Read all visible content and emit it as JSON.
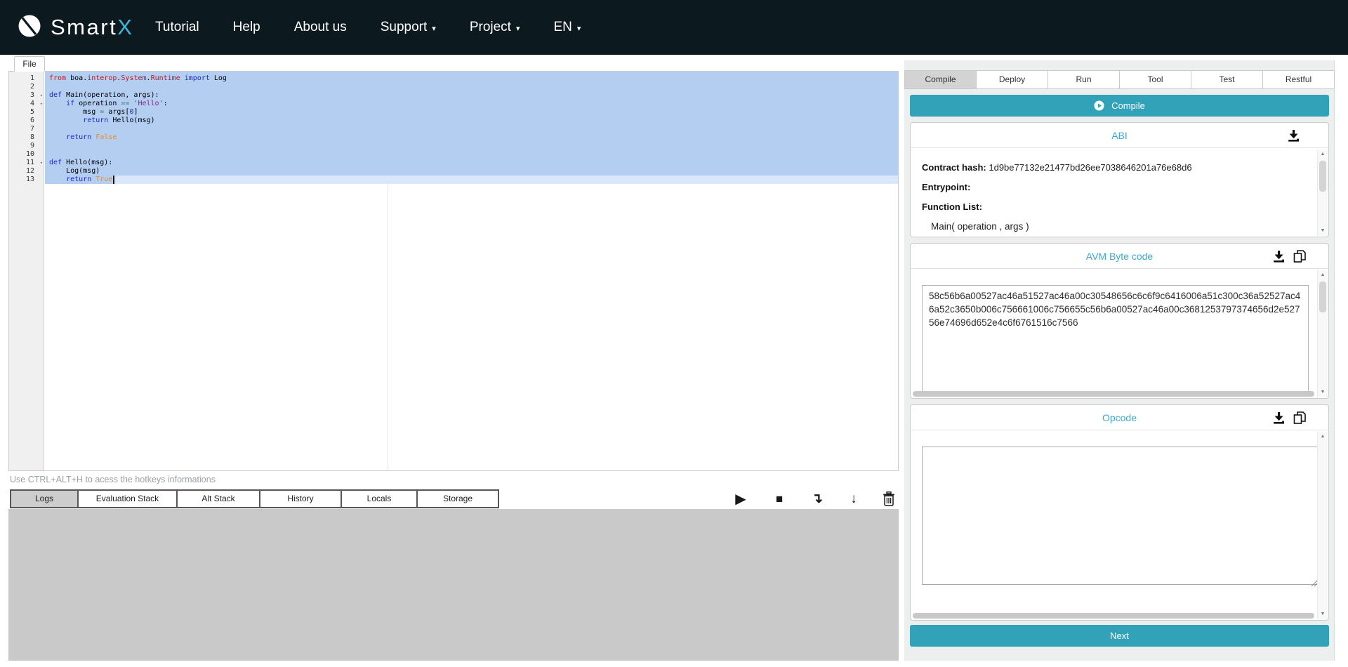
{
  "navbar": {
    "brand": {
      "prefix": "Smart",
      "suffix": "X"
    },
    "items": [
      {
        "label": "Tutorial",
        "caret": false
      },
      {
        "label": "Help",
        "caret": false
      },
      {
        "label": "About us",
        "caret": false
      },
      {
        "label": "Support",
        "caret": true
      },
      {
        "label": "Project",
        "caret": true
      },
      {
        "label": "EN",
        "caret": true
      }
    ]
  },
  "file_tab_label": "File",
  "editor": {
    "hint": "Use CTRL+ALT+H to acess the hotkeys informations",
    "lines": [
      {
        "n": 1,
        "fold": false,
        "tokens": [
          [
            "from",
            "red"
          ],
          [
            " ",
            "p"
          ],
          [
            "boa",
            ""
          ],
          [
            ".",
            "p"
          ],
          [
            "interop",
            "red"
          ],
          [
            ".",
            "p"
          ],
          [
            "System",
            "red"
          ],
          [
            ".",
            "p"
          ],
          [
            "Runtime",
            "red"
          ],
          [
            " ",
            "p"
          ],
          [
            "import",
            "kw"
          ],
          [
            " Log",
            "p"
          ]
        ]
      },
      {
        "n": 2,
        "tokens": []
      },
      {
        "n": 3,
        "fold": true,
        "tokens": [
          [
            "def",
            "kw"
          ],
          [
            " Main(operation, args):",
            "p"
          ]
        ]
      },
      {
        "n": 4,
        "fold": true,
        "tokens": [
          [
            "    ",
            "p"
          ],
          [
            "if",
            "kw"
          ],
          [
            " operation ",
            "p"
          ],
          [
            "==",
            "op"
          ],
          [
            " ",
            "p"
          ],
          [
            "'Hello'",
            "str"
          ],
          [
            ":",
            "p"
          ]
        ]
      },
      {
        "n": 5,
        "tokens": [
          [
            "        msg ",
            "p"
          ],
          [
            "=",
            "op"
          ],
          [
            " args[",
            "p"
          ],
          [
            "0",
            "num"
          ],
          [
            "]",
            "p"
          ]
        ]
      },
      {
        "n": 6,
        "tokens": [
          [
            "        ",
            "p"
          ],
          [
            "return",
            "kw"
          ],
          [
            " Hello(msg)",
            "p"
          ]
        ]
      },
      {
        "n": 7,
        "tokens": []
      },
      {
        "n": 8,
        "tokens": [
          [
            "    ",
            "p"
          ],
          [
            "return",
            "kw"
          ],
          [
            " ",
            "p"
          ],
          [
            "False",
            "const"
          ]
        ]
      },
      {
        "n": 9,
        "tokens": []
      },
      {
        "n": 10,
        "tokens": []
      },
      {
        "n": 11,
        "fold": true,
        "tokens": [
          [
            "def",
            "kw"
          ],
          [
            " Hello(msg):",
            "p"
          ]
        ]
      },
      {
        "n": 12,
        "tokens": [
          [
            "    Log(msg)",
            "p"
          ]
        ]
      },
      {
        "n": 13,
        "active": true,
        "tokens": [
          [
            "    ",
            "p"
          ],
          [
            "return",
            "kw"
          ],
          [
            " ",
            "p"
          ],
          [
            "True",
            "const"
          ]
        ]
      }
    ]
  },
  "debug_toolbar": {
    "tabs": [
      {
        "label": "Logs",
        "active": true
      },
      {
        "label": "Evaluation Stack",
        "active": false
      },
      {
        "label": "Alt Stack",
        "active": false
      },
      {
        "label": "History",
        "active": false
      },
      {
        "label": "Locals",
        "active": false
      },
      {
        "label": "Storage",
        "active": false
      }
    ],
    "icons": [
      {
        "name": "run-icon",
        "glyph": "▶",
        "cls": "gl-play"
      },
      {
        "name": "stop-icon",
        "glyph": "■",
        "cls": "gl-stop"
      },
      {
        "name": "step-over-icon",
        "glyph": "↴",
        "cls": "gl-arr"
      },
      {
        "name": "step-into-icon",
        "glyph": "↓",
        "cls": "gl-arr"
      },
      {
        "name": "clear-logs-icon",
        "glyph": "trash",
        "cls": ""
      }
    ]
  },
  "panel": {
    "tabs": [
      {
        "label": "Compile",
        "active": true
      },
      {
        "label": "Deploy",
        "active": false
      },
      {
        "label": "Run",
        "active": false
      },
      {
        "label": "Tool",
        "active": false
      },
      {
        "label": "Test",
        "active": false
      },
      {
        "label": "Restful",
        "active": false
      }
    ],
    "compile_button_label": "Compile",
    "abi": {
      "title": "ABI",
      "contract_hash_label": "Contract hash:",
      "contract_hash": "1d9be77132e21477bd26ee7038646201a76e68d6",
      "entrypoint_label": "Entrypoint:",
      "function_list_label": "Function List:",
      "function_signature": "Main( operation , args )"
    },
    "avm": {
      "title": "AVM Byte code",
      "bytecode": "58c56b6a00527ac46a51527ac46a00c30548656c6c6f9c6416006a51c300c36a52527ac46a52c3650b006c756661006c756655c56b6a00527ac46a00c3681253797374656d2e52756e74696d652e4c6f6761516c7566"
    },
    "opcode": {
      "title": "Opcode",
      "value": ""
    },
    "next_button_label": "Next"
  },
  "colors": {
    "accent_teal": "#32a2b9",
    "heading_teal": "#3eaacb",
    "navbar_bg": "#0c191e",
    "selection_blue": "#b4cef1"
  }
}
